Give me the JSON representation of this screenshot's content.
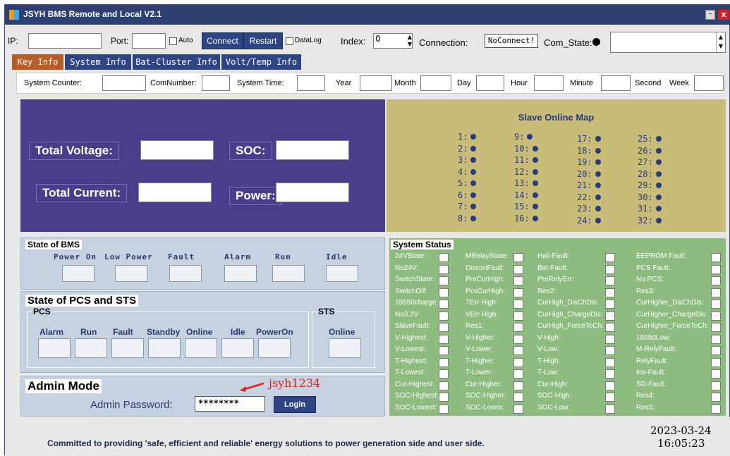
{
  "titlebar": {
    "title": "JSYH BMS Remote and Local V2.1",
    "min": "–",
    "close": "x"
  },
  "toolbar": {
    "ip_label": "IP:",
    "port_label": "Port:",
    "auto_label": "Auto",
    "connect_label": "Connect",
    "restart_label": "Restart",
    "datalog_label": "DataLog",
    "index_label": "Index:",
    "index_value": "0",
    "connection_label": "Connection:",
    "connection_value": "NoConnect!",
    "comstate_label": "Com_State:"
  },
  "tabs": [
    "Key Info",
    "System Info",
    "Bat-Cluster Info",
    "Volt/Temp Info"
  ],
  "strip": {
    "system_counter": "System Counter:",
    "comnumber": "ComNumber:",
    "system_time": "System Time:",
    "year": "Year",
    "month": "Month",
    "day": "Day",
    "hour": "Hour",
    "minute": "Minute",
    "second": "Second",
    "week": "Week"
  },
  "key": {
    "total_voltage": "Total Voltage:",
    "soc": "SOC:",
    "total_current": "Total Current:",
    "power": "Power:"
  },
  "slave_map": {
    "title": "Slave Online Map",
    "items": [
      "1:",
      "2:",
      "3:",
      "4:",
      "5:",
      "6:",
      "7:",
      "8:",
      "9:",
      "10:",
      "11:",
      "12:",
      "13:",
      "14:",
      "15:",
      "16:",
      "17:",
      "18:",
      "19:",
      "20:",
      "21:",
      "22:",
      "23:",
      "24:",
      "25:",
      "26:",
      "27:",
      "28:",
      "29:",
      "30:",
      "31:",
      "32:"
    ]
  },
  "bms_state": {
    "title": "State of BMS",
    "labels": [
      "Power On",
      "Low Power",
      "Fault",
      "Alarm",
      "Run",
      "Idle"
    ]
  },
  "pcs_sts": {
    "title": "State of PCS and STS",
    "pcs_title": "PCS",
    "sts_title": "STS",
    "pcs_labels": [
      "Alarm",
      "Run",
      "Fault",
      "Standby",
      "Online",
      "Idle",
      "PowerOn"
    ],
    "sts_labels": [
      "Online"
    ]
  },
  "admin": {
    "title": "Admin Mode",
    "password_label": "Admin Password:",
    "password_value": "********",
    "annotation": "jsyh1234",
    "login_label": "Login"
  },
  "system_status": {
    "title": "System Status",
    "col1": [
      "24VState:",
      "No24V:",
      "SwitchState:",
      "SwitchOff:",
      "18650charge:",
      "No3.3V",
      "SlaveFault:",
      "V-Highest:",
      "V-Lowest:",
      "T-Highest:",
      "T-Lowest:",
      "Cur-Highest:",
      "SOC-Highest:",
      "SOC-Lowest:"
    ],
    "col2": [
      "MRelayState:",
      "DisconFault:",
      "PreCurHigh:",
      "PcsCurHigh:",
      "TErr High:",
      "VErr High:",
      "Res1:",
      "V-Higher:",
      "V-Lower:",
      "T-Higher:",
      "T-Lower:",
      "Cur-Higher:",
      "SOC-Higher:",
      "SOC-Lower:"
    ],
    "col3": [
      "Hall-Fault:",
      "Bat-Fault:",
      "PreRelyErr:",
      "Res2:",
      "CurHigh_DisChDis:",
      "CurHigh_ChargeDis:",
      "CurHigh_ForceToCh:",
      "V-High:",
      "V-Low:",
      "T-High:",
      "T-Low:",
      "Cur-High:",
      "SOC-High:",
      "SOC-Low:"
    ],
    "col4": [
      "EEPROM Fault:",
      "PCS Fault:",
      "No PCS:",
      "Res3:",
      "CurHigher_DisChDis:",
      "CurHigher_ChargeDis:",
      "CurHigher_ForceToCh:",
      "18650Low:",
      "M-RelyFault:",
      "RelyFault:",
      "Ins-Fault:",
      "SD-Fault:",
      "Res4:",
      "Res5:"
    ]
  },
  "footer": {
    "motto": "Committed to providing 'safe, efficient and reliable' energy solutions to power generation side and user side.",
    "date": "2023-03-24",
    "time": "16:05:23"
  },
  "colors": {
    "titlebar": "#2e3f72",
    "blue_panel": "#4a3e8c",
    "olive_panel": "#c8bc78",
    "green_panel": "#8ebc80",
    "active_tab": "#b85d2a",
    "annotation": "#e0201a"
  }
}
